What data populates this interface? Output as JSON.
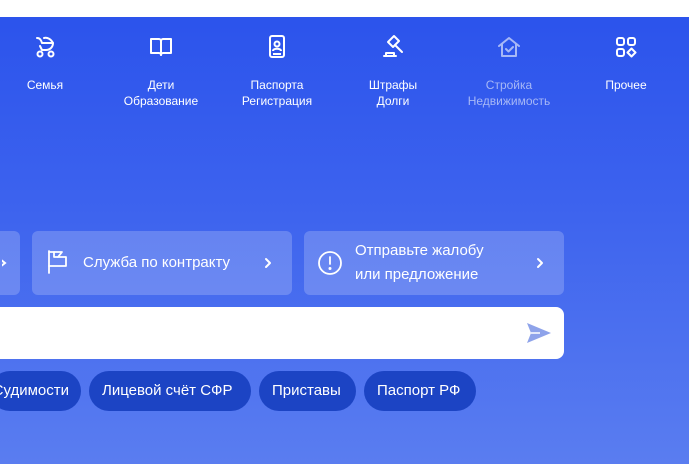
{
  "nav": {
    "items": [
      {
        "label_line1": "Семья",
        "label_line2": "",
        "icon": "stroller-icon"
      },
      {
        "label_line1": "Дети",
        "label_line2": "Образование",
        "icon": "book-icon"
      },
      {
        "label_line1": "Паспорта",
        "label_line2": "Регистрация",
        "icon": "passport-icon"
      },
      {
        "label_line1": "Штрафы",
        "label_line2": "Долги",
        "icon": "gavel-icon"
      },
      {
        "label_line1": "Стройка",
        "label_line2": "Недвижимость",
        "icon": "house-icon"
      },
      {
        "label_line1": "Прочее",
        "label_line2": "",
        "icon": "grid-icon"
      }
    ]
  },
  "cards": {
    "contract": {
      "label": "Служба по контракту",
      "icon": "flag-icon"
    },
    "complaint": {
      "line1": "Отправьте жалобу",
      "line2": "или предложение",
      "icon": "alert-circle-icon"
    }
  },
  "search": {
    "value": "",
    "placeholder": ""
  },
  "chips": [
    {
      "label": "Судимости"
    },
    {
      "label": "Лицевой счёт СФР"
    },
    {
      "label": "Приставы"
    },
    {
      "label": "Паспорт РФ"
    }
  ],
  "colors": {
    "background": "#2a52ec",
    "chip": "#1c44c4",
    "send": "#8ea3ea"
  }
}
